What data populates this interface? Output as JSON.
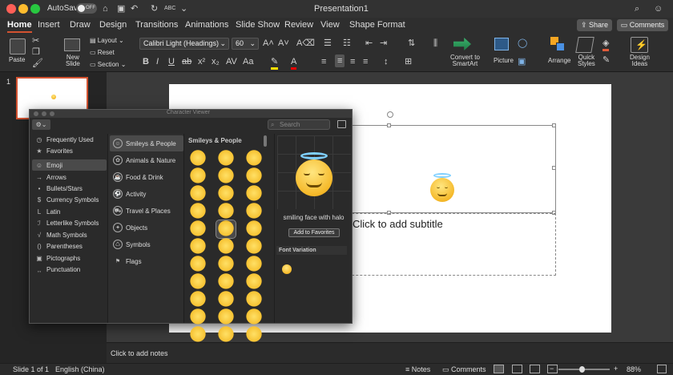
{
  "window": {
    "title": "Presentation1",
    "autosave_label": "AutoSave",
    "autosave_state": "OFF"
  },
  "tabs": [
    "Home",
    "Insert",
    "Draw",
    "Design",
    "Transitions",
    "Animations",
    "Slide Show",
    "Review",
    "View",
    "Shape Format"
  ],
  "share_label": "Share",
  "comments_label": "Comments",
  "ribbon": {
    "paste": "Paste",
    "new_slide": [
      "New",
      "Slide"
    ],
    "layout": "Layout",
    "reset": "Reset",
    "section": "Section",
    "font_name": "Calibri Light (Headings)",
    "font_size": "60",
    "convert_smartart": [
      "Convert to",
      "SmartArt"
    ],
    "picture": "Picture",
    "arrange": "Arrange",
    "quick_styles": [
      "Quick",
      "Styles"
    ],
    "design_ideas": [
      "Design",
      "Ideas"
    ]
  },
  "thumbnail": {
    "number": "1"
  },
  "slide": {
    "subtitle_placeholder": "Click to add subtitle"
  },
  "notes_placeholder": "Click to add notes",
  "status": {
    "slide": "Slide 1 of 1",
    "language": "English (China)",
    "notes": "Notes",
    "comments": "Comments",
    "zoom": "88%"
  },
  "character_viewer": {
    "title": "Character Viewer",
    "search_placeholder": "Search",
    "categories": [
      "Frequently Used",
      "Favorites",
      "Emoji",
      "Arrows",
      "Bullets/Stars",
      "Currency Symbols",
      "Latin",
      "Letterlike Symbols",
      "Math Symbols",
      "Parentheses",
      "Pictographs",
      "Punctuation"
    ],
    "selected_category": "Emoji",
    "subcategories": [
      "Smileys & People",
      "Animals & Nature",
      "Food & Drink",
      "Activity",
      "Travel & Places",
      "Objects",
      "Symbols",
      "Flags"
    ],
    "grid_header": "Smileys & People",
    "selected_name": "smiling face with halo",
    "add_favorites": "Add to Favorites",
    "font_variation": "Font Variation"
  },
  "colors": {
    "accent": "#d35230",
    "selection": "#4a4a4a"
  }
}
